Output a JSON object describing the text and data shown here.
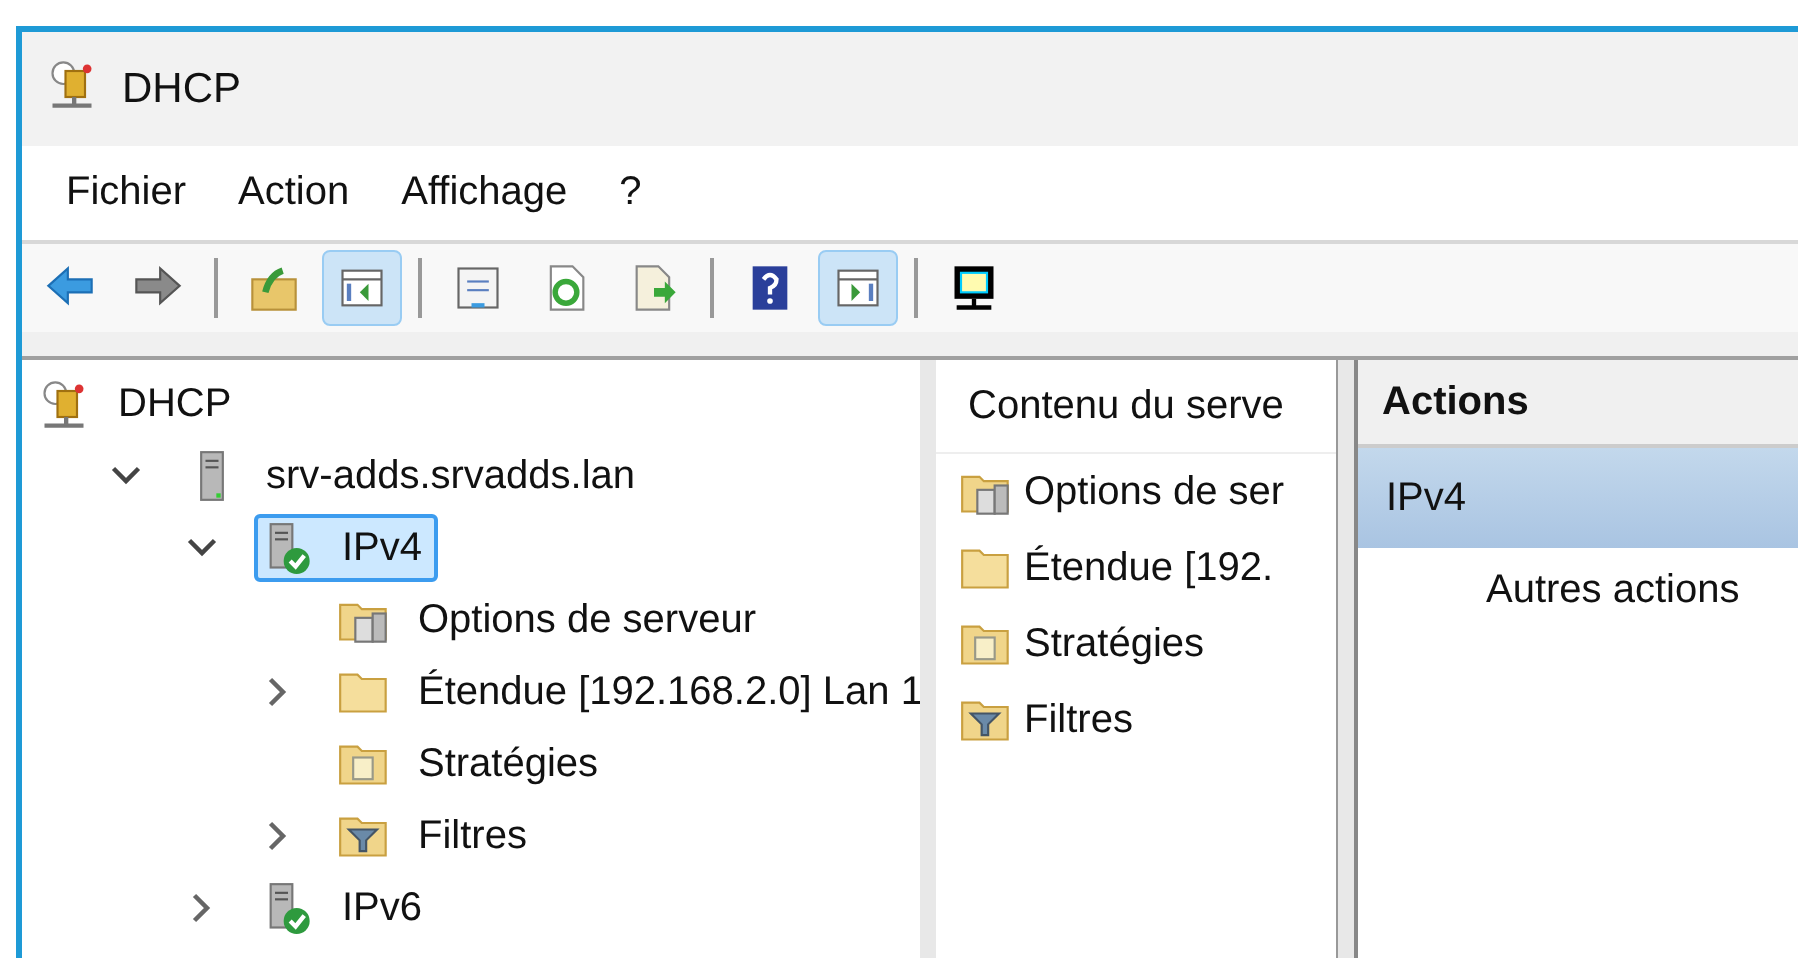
{
  "window": {
    "title": "DHCP"
  },
  "menu": [
    "Fichier",
    "Action",
    "Affichage",
    "?"
  ],
  "toolbar": [
    {
      "kind": "back",
      "pressed": false
    },
    {
      "kind": "forward",
      "pressed": false
    },
    {
      "kind": "separator"
    },
    {
      "kind": "up",
      "pressed": false
    },
    {
      "kind": "tree-toggle",
      "pressed": true
    },
    {
      "kind": "separator"
    },
    {
      "kind": "properties",
      "pressed": false
    },
    {
      "kind": "refresh",
      "pressed": false
    },
    {
      "kind": "export",
      "pressed": false
    },
    {
      "kind": "separator"
    },
    {
      "kind": "help",
      "pressed": false
    },
    {
      "kind": "action-toggle",
      "pressed": true
    },
    {
      "kind": "separator"
    },
    {
      "kind": "monitor",
      "pressed": false
    }
  ],
  "tree": [
    {
      "label": "DHCP",
      "kind": "dhcp",
      "selected": false,
      "children": [
        {
          "label": "srv-adds.srvadds.lan",
          "kind": "server",
          "expanded": true,
          "selected": false,
          "children": [
            {
              "label": "IPv4",
              "kind": "server-ok",
              "expanded": true,
              "selected": true,
              "children": [
                {
                  "label": "Options de serveur",
                  "kind": "options",
                  "selected": false
                },
                {
                  "label": "Étendue [192.168.2.0] Lan 1",
                  "kind": "folder",
                  "expanded": false,
                  "selected": false
                },
                {
                  "label": "Stratégies",
                  "kind": "policy",
                  "selected": false
                },
                {
                  "label": "Filtres",
                  "kind": "filter",
                  "expanded": false,
                  "selected": false
                }
              ]
            },
            {
              "label": "IPv6",
              "kind": "server-ok",
              "expanded": false,
              "selected": false
            }
          ]
        }
      ]
    }
  ],
  "content": {
    "header": "Contenu du serve",
    "items": [
      {
        "label": "Options de ser",
        "kind": "options"
      },
      {
        "label": "Étendue [192.",
        "kind": "folder"
      },
      {
        "label": "Stratégies",
        "kind": "policy"
      },
      {
        "label": "Filtres",
        "kind": "filter"
      }
    ]
  },
  "actions": {
    "header": "Actions",
    "section": "IPv4",
    "items": [
      "Autres actions"
    ]
  }
}
